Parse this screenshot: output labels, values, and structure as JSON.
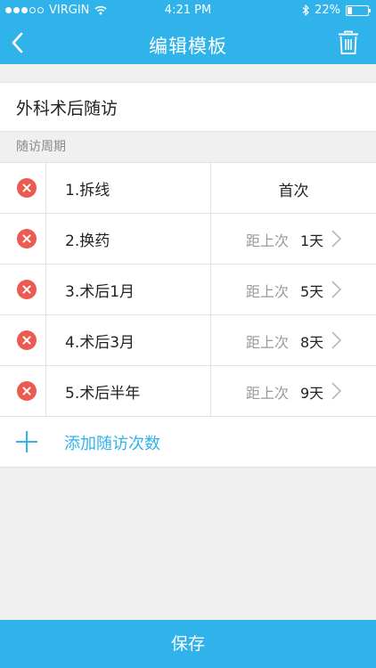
{
  "status_bar": {
    "carrier": "VIRGIN",
    "time": "4:21 PM",
    "battery_text": "22%",
    "battery_level": 0.22
  },
  "nav": {
    "title": "编辑模板",
    "back_icon": "chevron-left-icon",
    "trash_icon": "trash-icon"
  },
  "template": {
    "name": "外科术后随访"
  },
  "section": {
    "label": "随访周期"
  },
  "rows": [
    {
      "name": "1.拆线",
      "first_label": "首次"
    },
    {
      "name": "2.换药",
      "interval_label": "距上次",
      "days": "1天"
    },
    {
      "name": "3.术后1月",
      "interval_label": "距上次",
      "days": "5天"
    },
    {
      "name": "4.术后3月",
      "interval_label": "距上次",
      "days": "8天"
    },
    {
      "name": "5.术后半年",
      "interval_label": "距上次",
      "days": "9天"
    }
  ],
  "add": {
    "label": "添加随访次数"
  },
  "save": {
    "label": "保存"
  },
  "colors": {
    "accent": "#2fb3ea",
    "delete": "#ec5b52",
    "background": "#f0f0f0"
  }
}
